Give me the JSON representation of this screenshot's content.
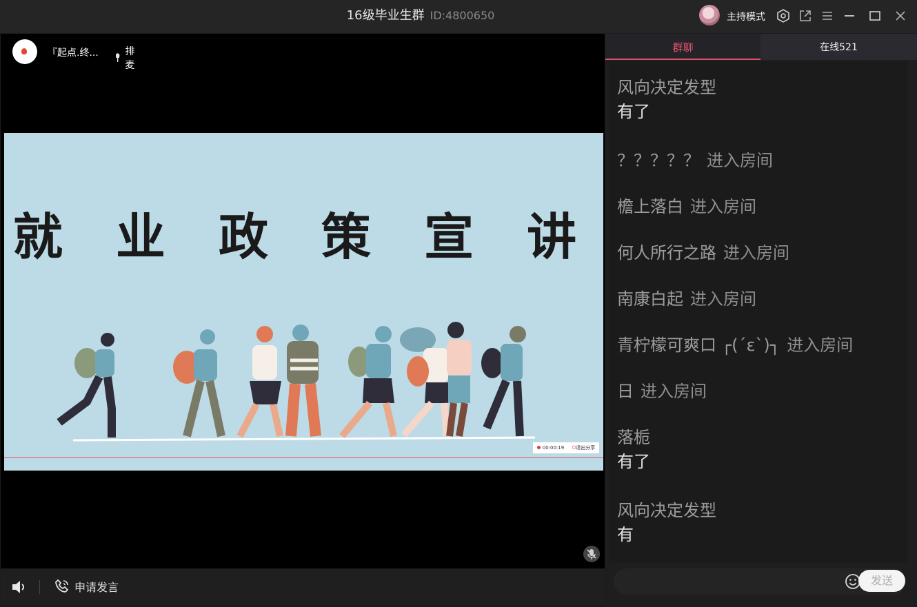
{
  "titlebar": {
    "group_name": "16级毕业生群",
    "group_id": "ID:4800650",
    "host_mode": "主持模式"
  },
  "video": {
    "room_name": "『起点.终...",
    "mic_queue": "排麦",
    "slide_title": "就 业 政 策 宣 讲",
    "record_time": "00:00:19",
    "exit_share": "退出分享"
  },
  "bottombar": {
    "apply_speak": "申请发言"
  },
  "panel": {
    "tab_group": "群聊",
    "tab_online": "在线521",
    "messages": [
      {
        "type": "chat",
        "user": "风向决定发型",
        "text": "有了"
      },
      {
        "type": "join",
        "user": "？？？？？",
        "action": "进入房间"
      },
      {
        "type": "join",
        "user": "檐上落白",
        "action": "进入房间"
      },
      {
        "type": "join",
        "user": "何人所行之路",
        "action": "进入房间"
      },
      {
        "type": "join",
        "user": "南康白起",
        "action": "进入房间"
      },
      {
        "type": "join",
        "user": "青柠檬可爽口 ┌(´ε`)┐",
        "action": "进入房间"
      },
      {
        "type": "join",
        "user": "日",
        "action": "进入房间"
      },
      {
        "type": "chat",
        "user": "落栀",
        "text": "有了"
      },
      {
        "type": "chat",
        "user": "风向决定发型",
        "text": "有"
      }
    ],
    "send_label": "发送"
  },
  "colors": {
    "accent": "#e0506e",
    "slide_bg": "#bcdbe7",
    "background": "#1c1c1c"
  }
}
